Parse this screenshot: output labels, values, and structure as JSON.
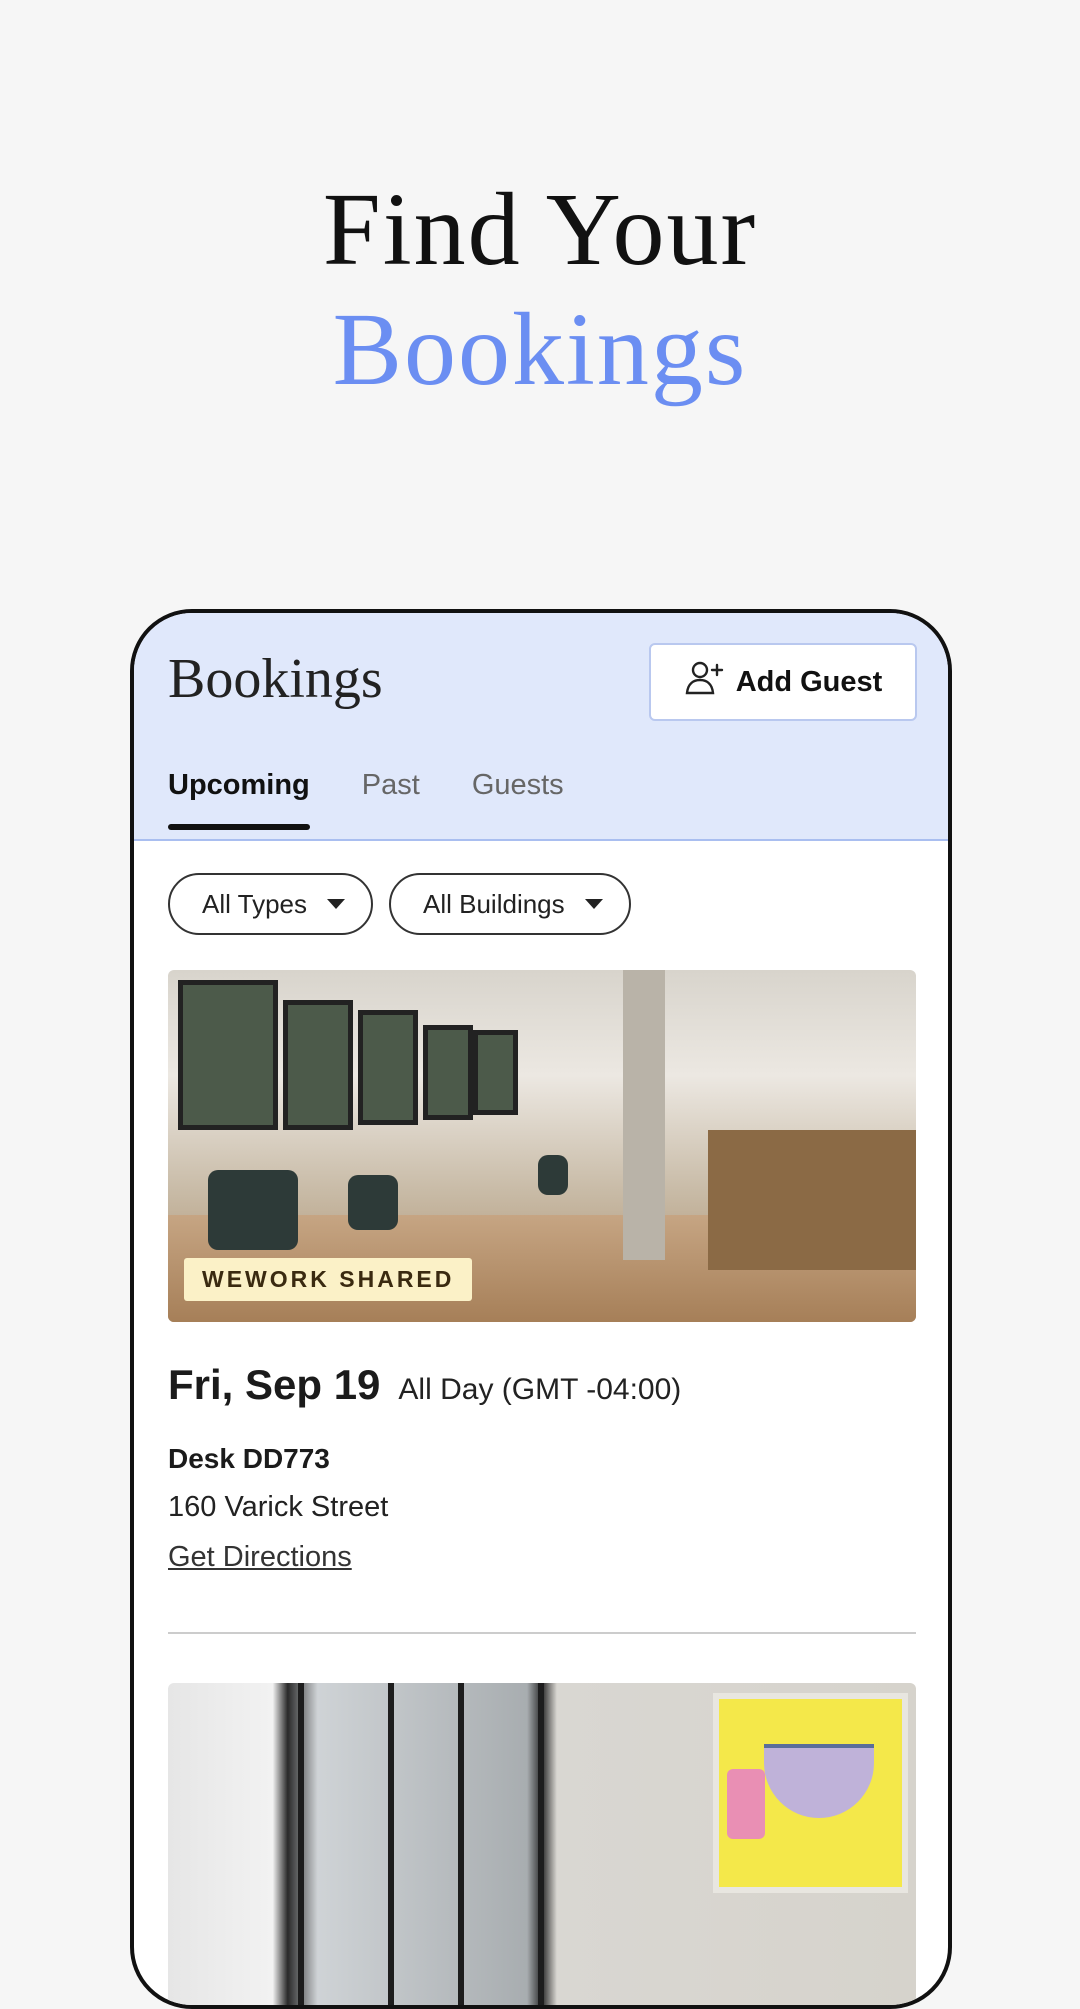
{
  "hero": {
    "line1": "Find Your",
    "line2": "Bookings"
  },
  "app": {
    "title": "Bookings",
    "add_guest_label": "Add Guest",
    "tabs": [
      {
        "label": "Upcoming",
        "active": true
      },
      {
        "label": "Past",
        "active": false
      },
      {
        "label": "Guests",
        "active": false
      }
    ],
    "filters": [
      {
        "label": "All Types"
      },
      {
        "label": "All Buildings"
      }
    ],
    "booking": {
      "badge": "WEWORK SHARED",
      "date": "Fri, Sep 19",
      "time": "All Day (GMT -04:00)",
      "desk": "Desk DD773",
      "address": "160 Varick Street",
      "directions_label": "Get Directions"
    }
  },
  "colors": {
    "accent": "#6b8ef2",
    "header_bg": "#e0e8fb",
    "badge_bg": "#fbf1c7"
  }
}
